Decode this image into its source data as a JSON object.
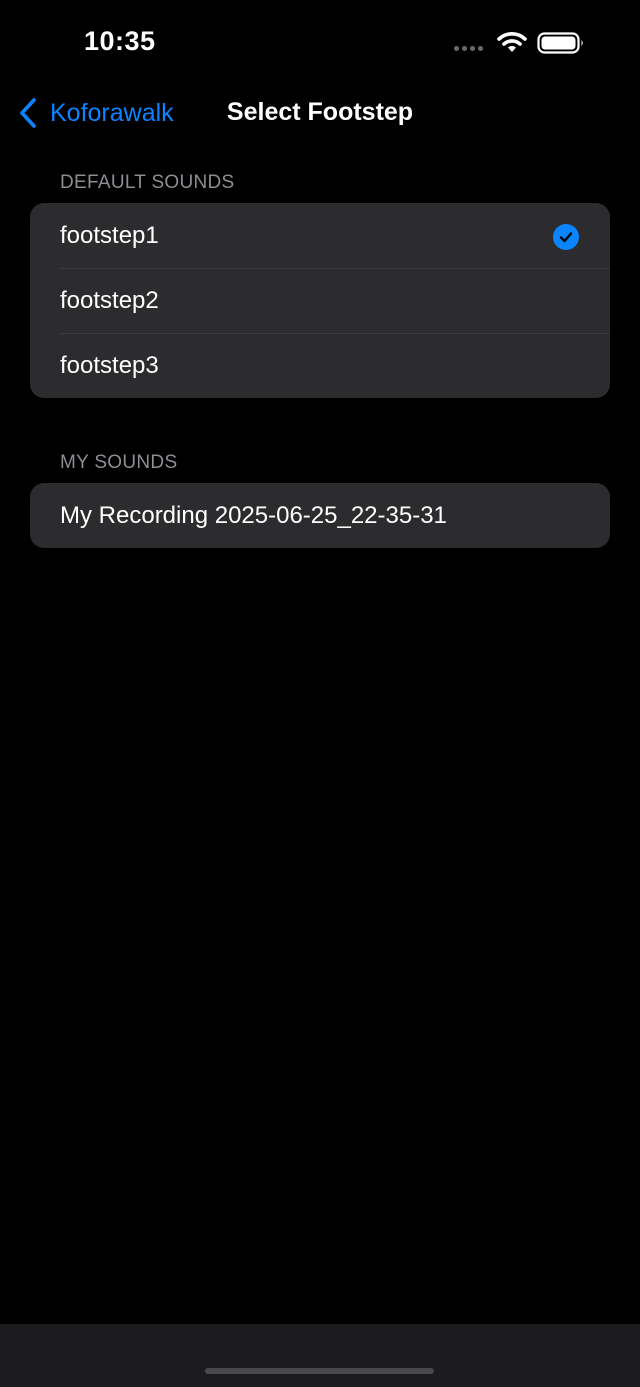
{
  "status_bar": {
    "time": "10:35"
  },
  "nav": {
    "back_label": "Koforawalk",
    "title": "Select Footstep"
  },
  "sections": {
    "default": {
      "header": "DEFAULT SOUNDS",
      "items": [
        {
          "label": "footstep1",
          "selected": true
        },
        {
          "label": "footstep2",
          "selected": false
        },
        {
          "label": "footstep3",
          "selected": false
        }
      ]
    },
    "mine": {
      "header": "MY SOUNDS",
      "items": [
        {
          "label": "My Recording 2025-06-25_22-35-31",
          "selected": false
        }
      ]
    }
  },
  "colors": {
    "accent": "#0a84ff",
    "background": "#000000",
    "cell": "#2c2c2e",
    "secondary_text": "#8d8d93"
  },
  "icons": {
    "back": "chevron-left-icon",
    "selected": "checkmark-circle-icon",
    "wifi": "wifi-icon",
    "battery": "battery-icon",
    "cellular": "cellular-signal-icon"
  }
}
